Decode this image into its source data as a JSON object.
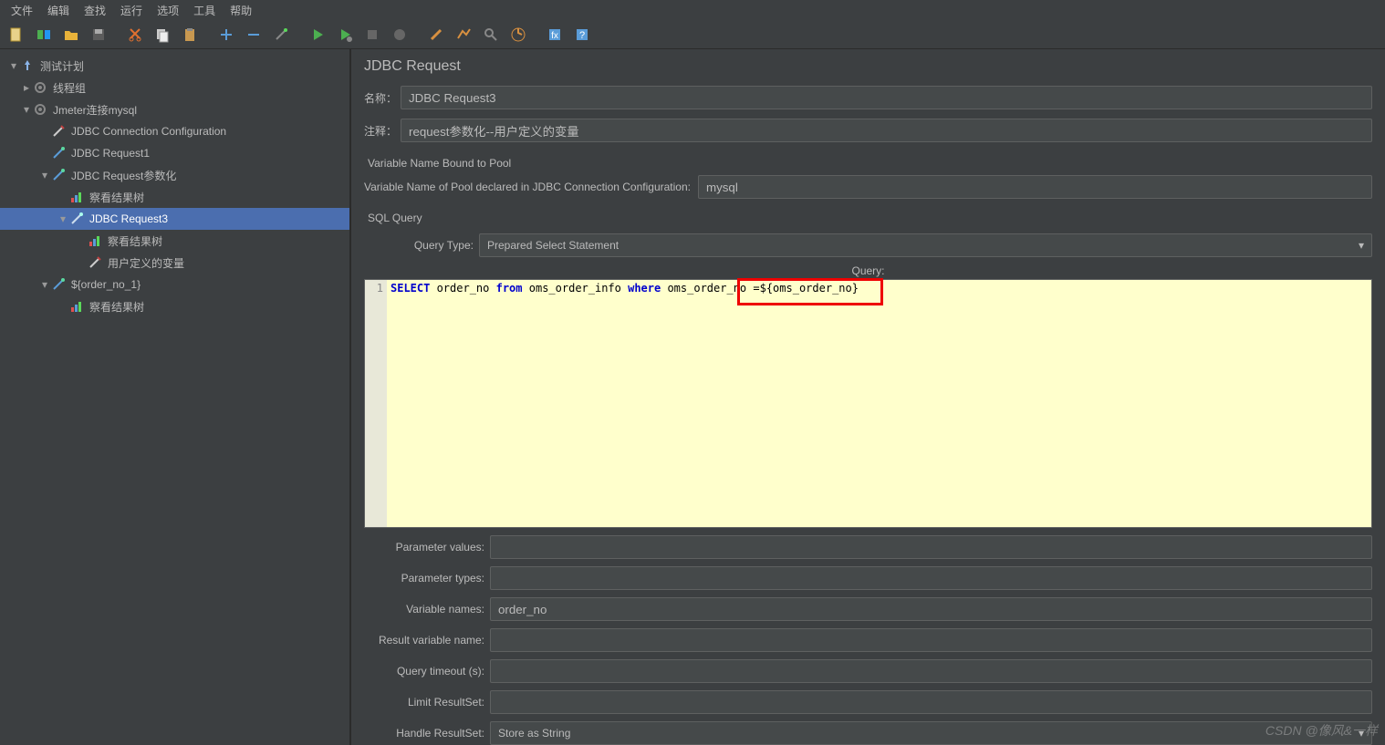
{
  "menu": {
    "file": "文件",
    "edit": "编辑",
    "search": "查找",
    "run": "运行",
    "options": "选项",
    "tools": "工具",
    "help": "帮助"
  },
  "tree": {
    "root": "测试计划",
    "threadGroup": "线程组",
    "jmeterMysql": "Jmeter连接mysql",
    "jdbcConn": "JDBC Connection Configuration",
    "jdbcReq1": "JDBC Request1",
    "jdbcReqParam": "JDBC Request参数化",
    "viewResults1": "察看结果树",
    "jdbcReq3": "JDBC Request3",
    "viewResults2": "察看结果树",
    "userVars": "用户定义的变量",
    "orderNo": "${order_no_1}",
    "viewResults3": "察看结果树"
  },
  "panel": {
    "title": "JDBC Request",
    "nameLabel": "名称：",
    "nameValue": "JDBC Request3",
    "commentLabel": "注释：",
    "commentValue": "request参数化--用户定义的变量",
    "poolSection": "Variable Name Bound to Pool",
    "poolLabel": "Variable Name of Pool declared in JDBC Connection Configuration:",
    "poolValue": "mysql",
    "sqlSection": "SQL Query",
    "queryTypeLabel": "Query Type:",
    "queryTypeValue": "Prepared Select Statement",
    "queryLabel": "Query:",
    "sql": {
      "select": "SELECT",
      "from": "from",
      "where": "where",
      "part1": " order_no ",
      "part2": " oms_order_info ",
      "part3": " oms_order_no =",
      "variable": "${oms_order_no}"
    },
    "paramValues": "Parameter values:",
    "paramTypes": "Parameter types:",
    "varNames": "Variable names:",
    "varNamesValue": "order_no",
    "resultVar": "Result variable name:",
    "queryTimeout": "Query timeout (s):",
    "limitResult": "Limit ResultSet:",
    "handleResult": "Handle ResultSet:",
    "handleResultValue": "Store as String"
  },
  "watermark": "CSDN @像风&一样"
}
